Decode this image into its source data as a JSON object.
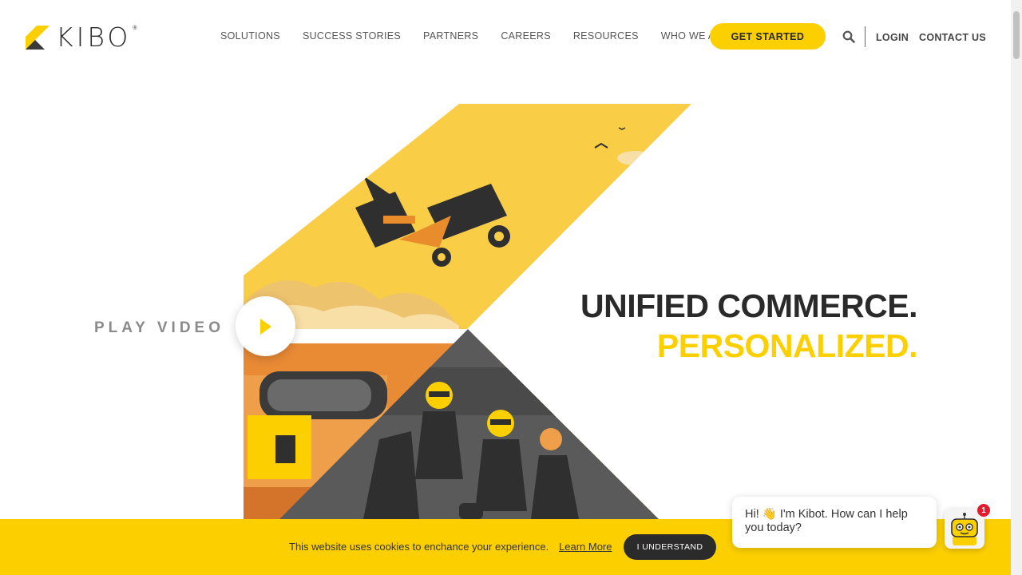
{
  "brand": {
    "logo_text": "KIBO",
    "logo_mark": "®",
    "accent_color": "#fcd000",
    "dark_color": "#2a2a2a"
  },
  "nav": {
    "items": [
      {
        "label": "SOLUTIONS"
      },
      {
        "label": "SUCCESS STORIES"
      },
      {
        "label": "PARTNERS"
      },
      {
        "label": "CAREERS"
      },
      {
        "label": "RESOURCES"
      },
      {
        "label": "WHO WE ARE"
      }
    ],
    "cta_label": "GET STARTED",
    "search_icon": "search-icon",
    "login_label": "LOGIN",
    "contact_label": "CONTACT US"
  },
  "hero": {
    "play_label": "PLAY VIDEO",
    "headline_line1": "UNIFIED COMMERCE.",
    "headline_line2": "PERSONALIZED."
  },
  "cookie": {
    "message": "This website uses cookies to enchance your experience.",
    "link_label": "Learn More",
    "button_label": "I UNDERSTAND"
  },
  "chat": {
    "greeting": "Hi! 👋 I'm Kibot. How can I help you today?",
    "badge_count": "1"
  }
}
